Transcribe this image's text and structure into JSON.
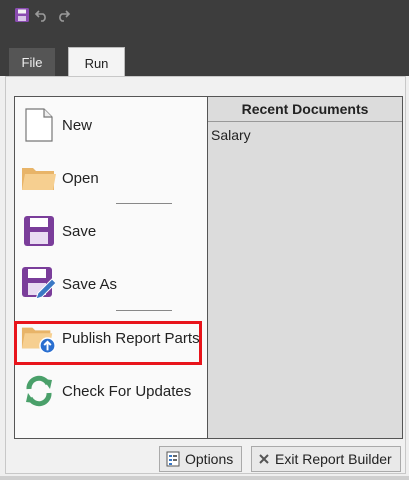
{
  "quick_access": {
    "save_icon": "floppy-disk-icon",
    "undo_icon": "undo-icon",
    "redo_icon": "redo-icon"
  },
  "tabs": [
    {
      "label": "File"
    },
    {
      "label": "Run"
    }
  ],
  "menu": {
    "items": [
      {
        "label": "New",
        "icon": "new-document-icon"
      },
      {
        "label": "Open",
        "icon": "folder-icon"
      },
      {
        "label": "Save",
        "icon": "floppy-disk-icon"
      },
      {
        "label": "Save As",
        "icon": "save-as-icon"
      },
      {
        "label": "Publish Report Parts",
        "icon": "publish-folder-icon"
      },
      {
        "label": "Check For Updates",
        "icon": "refresh-icon"
      }
    ]
  },
  "recent": {
    "header": "Recent Documents",
    "items": [
      "Salary"
    ]
  },
  "footer": {
    "options_label": "Options",
    "exit_label": "Exit Report Builder"
  },
  "colors": {
    "titlebar": "#3d3d3d",
    "save_purple": "#7a3d9a",
    "folder": "#f0c080",
    "highlight": "#e8141b",
    "refresh_green": "#4aa06a"
  }
}
